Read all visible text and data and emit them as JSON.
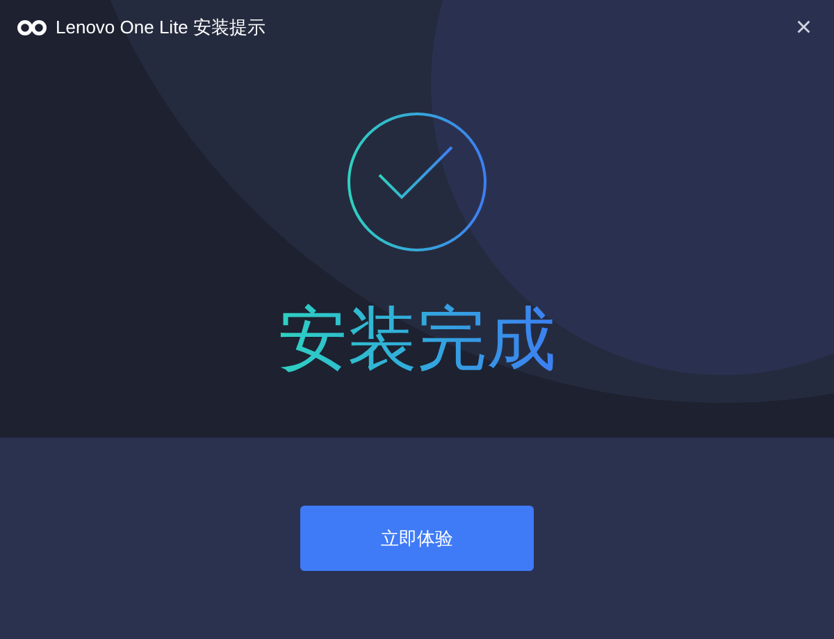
{
  "window": {
    "title": "Lenovo One Lite 安装提示",
    "close": "×"
  },
  "status": {
    "heading": "安装完成"
  },
  "buttons": [
    {
      "label": "立即体验"
    }
  ]
}
